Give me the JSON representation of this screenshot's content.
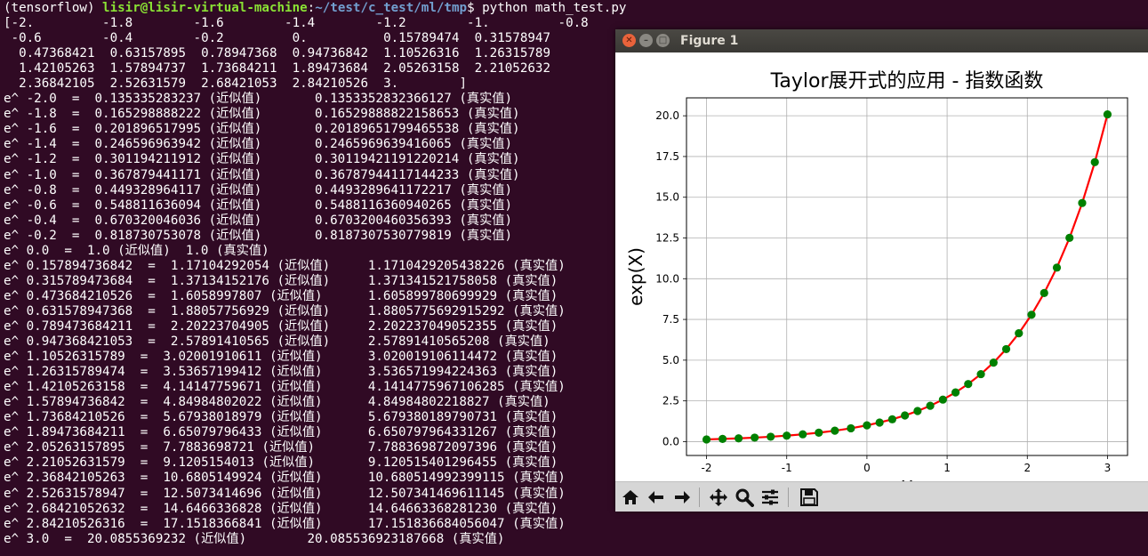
{
  "terminal": {
    "prompt_env": "(tensorflow) ",
    "prompt_user": "lisir@lisir-virtual-machine",
    "prompt_colon": ":",
    "prompt_path": "~/test/c_test/ml/tmp",
    "prompt_command": "$ python math_test.py",
    "array_lines": [
      "[-2.         -1.8        -1.6        -1.4        -1.2        -1.         -0.8",
      " -0.6        -0.4        -0.2         0.          0.15789474  0.31578947",
      "  0.47368421  0.63157895  0.78947368  0.94736842  1.10526316  1.26315789",
      "  1.42105263  1.57894737  1.73684211  1.89473684  2.05263158  2.21052632",
      "  2.36842105  2.52631579  2.68421053  2.84210526  3.        ]"
    ],
    "output_lines": [
      "e^ -2.0  =  0.135335283237 (近似值)       0.1353352832366127 (真实值)",
      "e^ -1.8  =  0.165298888222 (近似值)       0.16529888822158653 (真实值)",
      "e^ -1.6  =  0.201896517995 (近似值)       0.20189651799465538 (真实值)",
      "e^ -1.4  =  0.246596963942 (近似值)       0.2465969639416065 (真实值)",
      "e^ -1.2  =  0.301194211912 (近似值)       0.30119421191220214 (真实值)",
      "e^ -1.0  =  0.367879441171 (近似值)       0.36787944117144233 (真实值)",
      "e^ -0.8  =  0.449328964117 (近似值)       0.4493289641172217 (真实值)",
      "e^ -0.6  =  0.548811636094 (近似值)       0.5488116360940265 (真实值)",
      "e^ -0.4  =  0.670320046036 (近似值)       0.6703200460356393 (真实值)",
      "e^ -0.2  =  0.818730753078 (近似值)       0.8187307530779819 (真实值)",
      "e^ 0.0  =  1.0 (近似值)  1.0 (真实值)",
      "e^ 0.157894736842  =  1.17104292054 (近似值)     1.1710429205438226 (真实值)",
      "e^ 0.315789473684  =  1.37134152176 (近似值)     1.371341521758058 (真实值)",
      "e^ 0.473684210526  =  1.6058997807 (近似值)      1.605899780699929 (真实值)",
      "e^ 0.631578947368  =  1.88057756929 (近似值)     1.8805775692915292 (真实值)",
      "e^ 0.789473684211  =  2.20223704905 (近似值)     2.202237049052355 (真实值)",
      "e^ 0.947368421053  =  2.57891410565 (近似值)     2.57891410565208 (真实值)",
      "e^ 1.10526315789  =  3.02001910611 (近似值)      3.020019106114472 (真实值)",
      "e^ 1.26315789474  =  3.53657199412 (近似值)      3.536571994224363 (真实值)",
      "e^ 1.42105263158  =  4.14147759671 (近似值)      4.1414775967106285 (真实值)",
      "e^ 1.57894736842  =  4.84984802022 (近似值)      4.84984802218827 (真实值)",
      "e^ 1.73684210526  =  5.67938018979 (近似值)      5.679380189790731 (真实值)",
      "e^ 1.89473684211  =  6.65079796433 (近似值)      6.650797964331267 (真实值)",
      "e^ 2.05263157895  =  7.7883698721 (近似值)       7.788369872097396 (真实值)",
      "e^ 2.21052631579  =  9.1205154013 (近似值)       9.120515401296455 (真实值)",
      "e^ 2.36842105263  =  10.6805149924 (近似值)      10.680514992399115 (真实值)",
      "e^ 2.52631578947  =  12.5073414696 (近似值)      12.507341469611145 (真实值)",
      "e^ 2.68421052632  =  14.6466336828 (近似值)      14.64663368281230 (真实值)",
      "e^ 2.84210526316  =  17.1518366841 (近似值)      17.151836684056047 (真实值)",
      "e^ 3.0  =  20.0855369232 (近似值)        20.085536923187668 (真实值)"
    ]
  },
  "window": {
    "title": "Figure 1",
    "close_glyph": "✕",
    "min_glyph": "–",
    "max_glyph": "□"
  },
  "toolbar": {
    "buttons": [
      "home-icon",
      "back-icon",
      "forward-icon",
      "pan-icon",
      "zoom-icon",
      "configure-subplots-icon",
      "save-icon"
    ]
  },
  "chart_data": {
    "type": "line",
    "title": "Taylor展开式的应用 - 指数函数",
    "xlabel": "X",
    "ylabel": "exp(X)",
    "xlim": [
      -2.25,
      3.25
    ],
    "ylim": [
      -0.85,
      21.1
    ],
    "xticks": [
      "-2",
      "-1",
      "0",
      "1",
      "2",
      "3"
    ],
    "yticks": [
      "0.0",
      "2.5",
      "5.0",
      "7.5",
      "10.0",
      "12.5",
      "15.0",
      "17.5",
      "20.0"
    ],
    "grid": true,
    "line_color": "#ff0000",
    "marker_color": "#008000",
    "series": [
      {
        "x": [
          -2.0,
          -1.8,
          -1.6,
          -1.4,
          -1.2,
          -1.0,
          -0.8,
          -0.6,
          -0.4,
          -0.2,
          0.0,
          0.157894736842,
          0.315789473684,
          0.473684210526,
          0.631578947368,
          0.789473684211,
          0.947368421053,
          1.10526315789,
          1.26315789474,
          1.42105263158,
          1.57894736842,
          1.73684210526,
          1.89473684211,
          2.05263157895,
          2.21052631579,
          2.36842105263,
          2.52631578947,
          2.68421052632,
          2.84210526316,
          3.0
        ],
        "values": [
          0.135335283237,
          0.165298888222,
          0.201896517995,
          0.246596963942,
          0.301194211912,
          0.367879441171,
          0.449328964117,
          0.548811636094,
          0.670320046036,
          0.818730753078,
          1.0,
          1.17104292054,
          1.37134152176,
          1.6058997807,
          1.88057756929,
          2.20223704905,
          2.57891410565,
          3.02001910611,
          3.53657199412,
          4.14147759671,
          4.84984802022,
          5.67938018979,
          6.65079796433,
          7.7883698721,
          9.1205154013,
          10.6805149924,
          12.5073414696,
          14.6466336828,
          17.1518366841,
          20.0855369232
        ]
      }
    ]
  }
}
